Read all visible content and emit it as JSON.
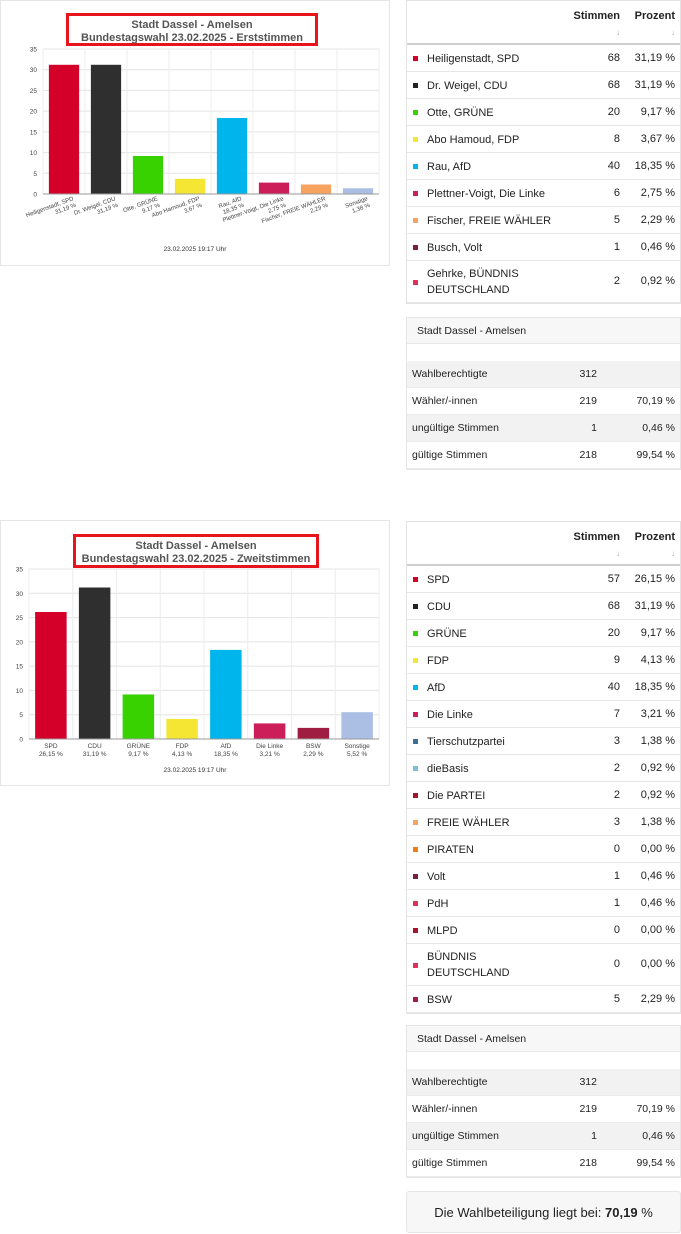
{
  "chart_data": [
    {
      "type": "bar",
      "title": "Stadt Dassel - Amelsen",
      "subtitle": "Bundestagswahl 23.02.2025  - Erststimmen",
      "categories": [
        "Heiligenstadt, SPD",
        "Dr. Weigel, CDU",
        "Otte, GRÜNE",
        "Abo Hamoud, FDP",
        "Rau, AfD",
        "Plettner-Voigt, Die Linke",
        "Fischer, FREIE WÄHLER",
        "Sonstige"
      ],
      "percent_labels": [
        "31,19 %",
        "31,19 %",
        "9,17 %",
        "3,67 %",
        "18,35 %",
        "2,75 %",
        "2,29 %",
        "1,38 %"
      ],
      "values": [
        31.19,
        31.19,
        9.17,
        3.67,
        18.35,
        2.75,
        2.29,
        1.38
      ],
      "colors": [
        "#d4002a",
        "#2f2f2f",
        "#37d200",
        "#f5e633",
        "#00b4ec",
        "#cc1f5a",
        "#f5a35e",
        "#aabfe3"
      ],
      "ylim": [
        0,
        35
      ],
      "yticks": [
        "0",
        "5",
        "10",
        "15",
        "20",
        "25",
        "30",
        "35"
      ],
      "rotated_labels": true,
      "grid": true,
      "timestamp": "23.02.2025 19:17 Uhr"
    },
    {
      "type": "bar",
      "title": "Stadt Dassel - Amelsen",
      "subtitle": "Bundestagswahl 23.02.2025  - Zweitstimmen",
      "categories": [
        "SPD",
        "CDU",
        "GRÜNE",
        "FDP",
        "AfD",
        "Die Linke",
        "BSW",
        "Sonstige"
      ],
      "percent_labels": [
        "26,15 %",
        "31,19 %",
        "9,17 %",
        "4,13 %",
        "18,35 %",
        "3,21 %",
        "2,29 %",
        "5,52 %"
      ],
      "values": [
        26.15,
        31.19,
        9.17,
        4.13,
        18.35,
        3.21,
        2.29,
        5.52
      ],
      "colors": [
        "#d4002a",
        "#2f2f2f",
        "#37d200",
        "#f5e633",
        "#00b4ec",
        "#cc1f5a",
        "#a01d42",
        "#aabfe3"
      ],
      "ylim": [
        0,
        35
      ],
      "yticks": [
        "0",
        "5",
        "10",
        "15",
        "20",
        "25",
        "30",
        "35"
      ],
      "rotated_labels": false,
      "grid": true,
      "timestamp": "23.02.2025 19:17 Uhr"
    }
  ],
  "tables": [
    {
      "col_votes": "Stimmen",
      "col_pct": "Prozent",
      "sort_icon": "↓",
      "rows": [
        {
          "name": "Heiligenstadt, SPD",
          "votes": "68",
          "pct": "31,19 %",
          "color": "#d4002a"
        },
        {
          "name": "Dr. Weigel, CDU",
          "votes": "68",
          "pct": "31,19 %",
          "color": "#222222"
        },
        {
          "name": "Otte, GRÜNE",
          "votes": "20",
          "pct": "9,17 %",
          "color": "#37d200"
        },
        {
          "name": "Abo Hamoud, FDP",
          "votes": "8",
          "pct": "3,67 %",
          "color": "#f5e633"
        },
        {
          "name": "Rau, AfD",
          "votes": "40",
          "pct": "18,35 %",
          "color": "#00b4ec"
        },
        {
          "name": "Plettner-Voigt, Die Linke",
          "votes": "6",
          "pct": "2,75 %",
          "color": "#cc1f5a"
        },
        {
          "name": "Fischer, FREIE WÄHLER",
          "votes": "5",
          "pct": "2,29 %",
          "color": "#f5a35e"
        },
        {
          "name": "Busch, Volt",
          "votes": "1",
          "pct": "0,46 %",
          "color": "#7a1f3d"
        },
        {
          "name": "Gehrke, BÜNDNIS DEUTSCHLAND",
          "votes": "2",
          "pct": "0,92 %",
          "color": "#e0305a"
        }
      ]
    },
    {
      "col_votes": "Stimmen",
      "col_pct": "Prozent",
      "sort_icon": "↓",
      "rows": [
        {
          "name": "SPD",
          "votes": "57",
          "pct": "26,15 %",
          "color": "#d4002a"
        },
        {
          "name": "CDU",
          "votes": "68",
          "pct": "31,19 %",
          "color": "#222222"
        },
        {
          "name": "GRÜNE",
          "votes": "20",
          "pct": "9,17 %",
          "color": "#37d200"
        },
        {
          "name": "FDP",
          "votes": "9",
          "pct": "4,13 %",
          "color": "#f5e633"
        },
        {
          "name": "AfD",
          "votes": "40",
          "pct": "18,35 %",
          "color": "#00b4ec"
        },
        {
          "name": "Die Linke",
          "votes": "7",
          "pct": "3,21 %",
          "color": "#cc1f5a"
        },
        {
          "name": "Tierschutzpartei",
          "votes": "3",
          "pct": "1,38 %",
          "color": "#3d6e96"
        },
        {
          "name": "dieBasis",
          "votes": "2",
          "pct": "0,92 %",
          "color": "#7dbfd8"
        },
        {
          "name": "Die PARTEI",
          "votes": "2",
          "pct": "0,92 %",
          "color": "#a3152a"
        },
        {
          "name": "FREIE WÄHLER",
          "votes": "3",
          "pct": "1,38 %",
          "color": "#f5a35e"
        },
        {
          "name": "PIRATEN",
          "votes": "0",
          "pct": "0,00 %",
          "color": "#ef7d1a"
        },
        {
          "name": "Volt",
          "votes": "1",
          "pct": "0,46 %",
          "color": "#7a1f3d"
        },
        {
          "name": "PdH",
          "votes": "1",
          "pct": "0,46 %",
          "color": "#e0305a"
        },
        {
          "name": "MLPD",
          "votes": "0",
          "pct": "0,00 %",
          "color": "#a3152a"
        },
        {
          "name": "BÜNDNIS DEUTSCHLAND",
          "votes": "0",
          "pct": "0,00 %",
          "color": "#e0305a"
        },
        {
          "name": "BSW",
          "votes": "5",
          "pct": "2,29 %",
          "color": "#a01d42"
        }
      ]
    }
  ],
  "summaries": [
    {
      "heading": "Stadt Dassel - Amelsen",
      "rows": [
        {
          "label": "Wahlberechtigte",
          "value": "312",
          "pct": ""
        },
        {
          "label": "Wähler/-innen",
          "value": "219",
          "pct": "70,19 %"
        },
        {
          "label": "ungültige Stimmen",
          "value": "1",
          "pct": "0,46 %"
        },
        {
          "label": "gültige Stimmen",
          "value": "218",
          "pct": "99,54 %"
        }
      ]
    },
    {
      "heading": "Stadt Dassel - Amelsen",
      "rows": [
        {
          "label": "Wahlberechtigte",
          "value": "312",
          "pct": ""
        },
        {
          "label": "Wähler/-innen",
          "value": "219",
          "pct": "70,19 %"
        },
        {
          "label": "ungültige Stimmen",
          "value": "1",
          "pct": "0,46 %"
        },
        {
          "label": "gültige Stimmen",
          "value": "218",
          "pct": "99,54 %"
        }
      ]
    }
  ],
  "turnout": {
    "text": "Die Wahlbeteiligung liegt bei:",
    "value": "70,19",
    "unit": "%"
  }
}
